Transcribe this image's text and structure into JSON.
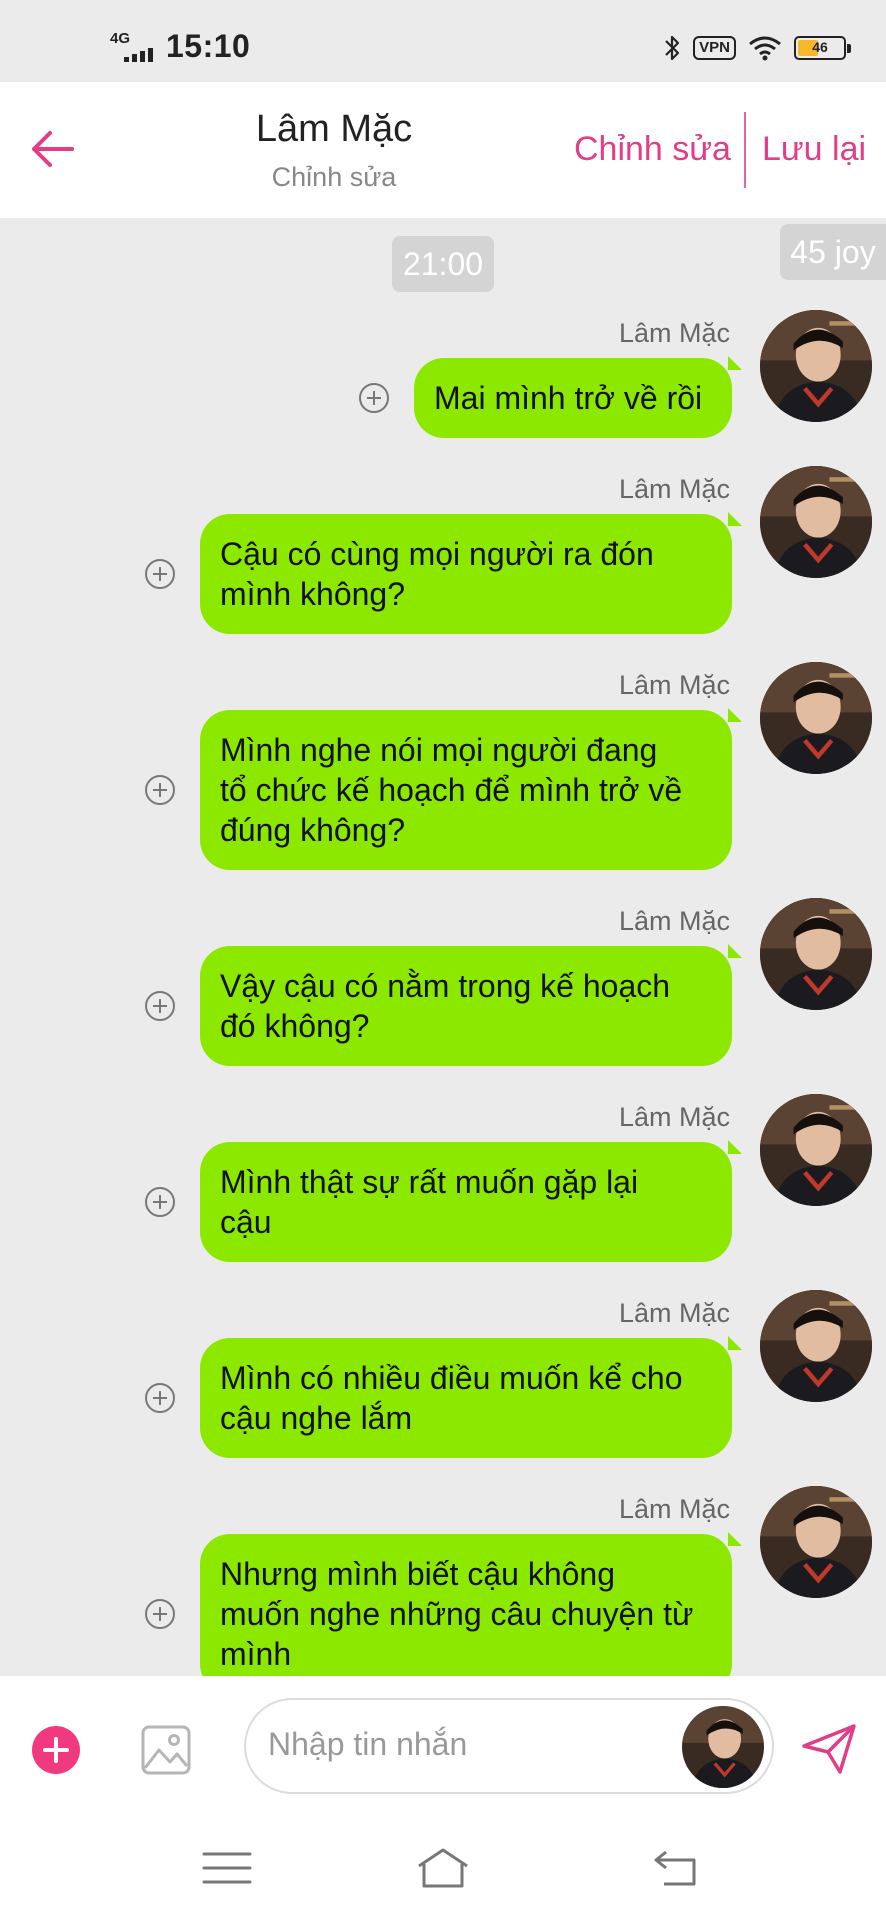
{
  "status_bar": {
    "network": "4G",
    "time": "15:10",
    "vpn_label": "VPN",
    "battery": "46",
    "battery_level": 0.46,
    "icons": [
      "bluetooth-icon",
      "wifi-icon",
      "battery-icon"
    ]
  },
  "header": {
    "title": "Lâm Mặc",
    "subtitle": "Chỉnh sửa",
    "edit_label": "Chỉnh sửa",
    "save_label": "Lưu lại",
    "accent_color": "#e23d86"
  },
  "chat": {
    "time_divider": "21:00",
    "joy_badge": "45 joy",
    "bubble_color": "#8de800",
    "messages": [
      {
        "sender": "Lâm Mặc",
        "lines": [
          "Mai mình trở về rồi"
        ]
      },
      {
        "sender": "Lâm Mặc",
        "lines": [
          "Cậu có cùng mọi người ra đón",
          "mình không?"
        ]
      },
      {
        "sender": "Lâm Mặc",
        "lines": [
          "Mình nghe nói mọi người đang",
          "tổ chức kế hoạch để mình trở về",
          "đúng không?"
        ]
      },
      {
        "sender": "Lâm Mặc",
        "lines": [
          "Vậy cậu có nằm trong kế hoạch",
          "đó không?"
        ]
      },
      {
        "sender": "Lâm Mặc",
        "lines": [
          "Mình thật sự rất muốn gặp lại",
          "cậu"
        ]
      },
      {
        "sender": "Lâm Mặc",
        "lines": [
          "Mình có nhiều điều muốn kể cho",
          "cậu nghe lắm"
        ]
      },
      {
        "sender": "Lâm Mặc",
        "lines": [
          "Nhưng mình biết cậu không",
          "muốn nghe những câu chuyện từ",
          "mình"
        ]
      }
    ]
  },
  "input": {
    "placeholder": "Nhập tin nhắn",
    "add_color": "#f0397e"
  }
}
